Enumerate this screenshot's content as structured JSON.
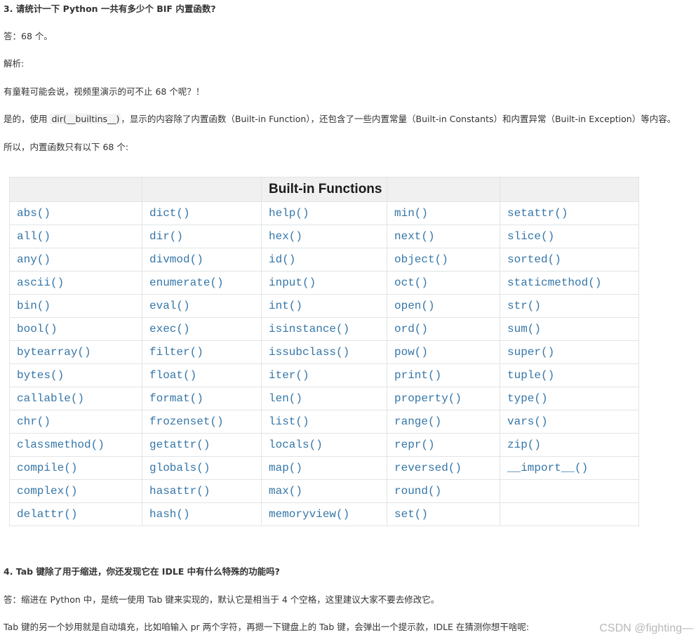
{
  "q3": {
    "title": "3. 请统计一下 Python 一共有多少个 BIF 内置函数?",
    "answer": "答：68 个。",
    "analysis_label": "解析:",
    "p1": "有童鞋可能会说，视频里演示的可不止 68 个呢？！",
    "p2_before": "是的，使用 ",
    "p2_code": "dir(__builtins__)",
    "p2_after": "，显示的内容除了内置函数（Built-in Function），还包含了一些内置常量（Built-in Constants）和内置异常（Built-in Exception）等内容。",
    "p3": "所以，内置函数只有以下 68 个:"
  },
  "table": {
    "headers": [
      "",
      "",
      "Built-in Functions",
      "",
      ""
    ],
    "rows": [
      [
        "abs()",
        "dict()",
        "help()",
        "min()",
        "setattr()"
      ],
      [
        "all()",
        "dir()",
        "hex()",
        "next()",
        "slice()"
      ],
      [
        "any()",
        "divmod()",
        "id()",
        "object()",
        "sorted()"
      ],
      [
        "ascii()",
        "enumerate()",
        "input()",
        "oct()",
        "staticmethod()"
      ],
      [
        "bin()",
        "eval()",
        "int()",
        "open()",
        "str()"
      ],
      [
        "bool()",
        "exec()",
        "isinstance()",
        "ord()",
        "sum()"
      ],
      [
        "bytearray()",
        "filter()",
        "issubclass()",
        "pow()",
        "super()"
      ],
      [
        "bytes()",
        "float()",
        "iter()",
        "print()",
        "tuple()"
      ],
      [
        "callable()",
        "format()",
        "len()",
        "property()",
        "type()"
      ],
      [
        "chr()",
        "frozenset()",
        "list()",
        "range()",
        "vars()"
      ],
      [
        "classmethod()",
        "getattr()",
        "locals()",
        "repr()",
        "zip()"
      ],
      [
        "compile()",
        "globals()",
        "map()",
        "reversed()",
        "__import__()"
      ],
      [
        "complex()",
        "hasattr()",
        "max()",
        "round()",
        ""
      ],
      [
        "delattr()",
        "hash()",
        "memoryview()",
        "set()",
        ""
      ]
    ]
  },
  "q4": {
    "title": "4. Tab 键除了用于缩进，你还发现它在 IDLE 中有什么特殊的功能吗?",
    "answer": "答：缩进在 Python 中，是统一使用 Tab 键来实现的，默认它是相当于 4 个空格，这里建议大家不要去修改它。",
    "p1": "Tab 键的另一个妙用就是自动填充，比如咱输入 pr 两个字符，再摁一下键盘上的 Tab 键，会弹出一个提示款，IDLE 在猜测你想干啥呢:"
  },
  "watermark": "CSDN @fighting—",
  "colors": {
    "link": "#3576a8",
    "header_bg": "#f0f0f0",
    "border": "#e1e4e5",
    "text": "#333333"
  }
}
